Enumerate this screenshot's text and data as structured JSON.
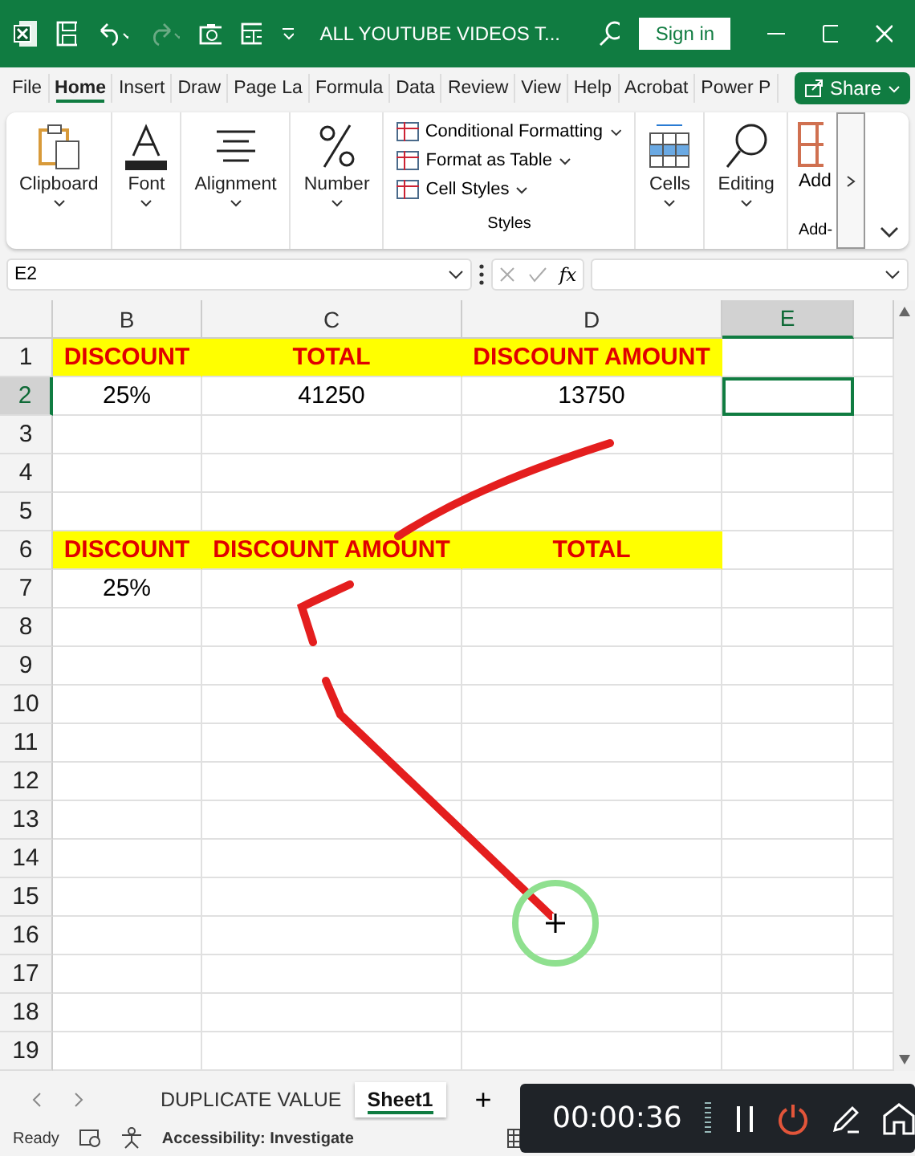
{
  "title_bar": {
    "title": "ALL YOUTUBE VIDEOS T...",
    "sign_in": "Sign in"
  },
  "ribbon_tabs": [
    {
      "label": "File",
      "selected": false
    },
    {
      "label": "Home",
      "selected": true
    },
    {
      "label": "Insert",
      "selected": false
    },
    {
      "label": "Draw",
      "selected": false
    },
    {
      "label": "Page La",
      "selected": false
    },
    {
      "label": "Formula",
      "selected": false
    },
    {
      "label": "Data",
      "selected": false
    },
    {
      "label": "Review",
      "selected": false
    },
    {
      "label": "View",
      "selected": false
    },
    {
      "label": "Help",
      "selected": false
    },
    {
      "label": "Acrobat",
      "selected": false
    },
    {
      "label": "Power P",
      "selected": false
    }
  ],
  "share": "Share",
  "ribbon_groups": [
    {
      "kind": "big",
      "label": "Clipboard"
    },
    {
      "kind": "big",
      "label": "Font"
    },
    {
      "kind": "big",
      "label": "Alignment"
    },
    {
      "kind": "big",
      "label": "Number"
    },
    {
      "kind": "styles",
      "label": "Styles",
      "items": [
        "Conditional Formatting",
        "Format as Table",
        "Cell Styles"
      ]
    },
    {
      "kind": "big",
      "label": "Cells"
    },
    {
      "kind": "big",
      "label": "Editing"
    },
    {
      "kind": "addins",
      "label": "Add",
      "group_label": "Add-"
    }
  ],
  "formula_bar": {
    "name_box": "E2",
    "fx": "fx"
  },
  "sheet": {
    "columns": [
      {
        "label": "B",
        "selected": false
      },
      {
        "label": "C",
        "selected": false
      },
      {
        "label": "D",
        "selected": false
      },
      {
        "label": "E",
        "selected": true
      }
    ],
    "rows": [
      {
        "header": "1",
        "selected": false,
        "cells": [
          {
            "kind": "heading",
            "text": "DISCOUNT",
            "selected": false
          },
          {
            "kind": "heading",
            "text": "TOTAL",
            "selected": false
          },
          {
            "kind": "heading",
            "text": "DISCOUNT AMOUNT",
            "selected": false
          }
        ]
      },
      {
        "header": "2",
        "selected": true,
        "cells": [
          {
            "kind": "value",
            "text": "25%",
            "selected": false
          },
          {
            "kind": "value",
            "text": "41250",
            "selected": false
          },
          {
            "kind": "value",
            "text": "13750",
            "selected": false
          },
          {
            "kind": "value",
            "selected": true
          }
        ]
      },
      {
        "header": "3",
        "selected": false
      },
      {
        "header": "4",
        "selected": false
      },
      {
        "header": "5",
        "selected": false
      },
      {
        "header": "6",
        "selected": false,
        "cells": [
          {
            "kind": "heading",
            "text": "DISCOUNT",
            "selected": false
          },
          {
            "kind": "heading",
            "text": "DISCOUNT AMOUNT",
            "selected": false
          },
          {
            "kind": "heading",
            "text": "TOTAL",
            "selected": false
          }
        ]
      },
      {
        "header": "7",
        "selected": false,
        "cells": [
          {
            "kind": "value",
            "text": "25%",
            "selected": false
          }
        ]
      },
      {
        "header": "8",
        "selected": false
      },
      {
        "header": "9",
        "selected": false
      },
      {
        "header": "10",
        "selected": false
      },
      {
        "header": "11",
        "selected": false
      },
      {
        "header": "12",
        "selected": false
      },
      {
        "header": "13",
        "selected": false
      },
      {
        "header": "14",
        "selected": false
      },
      {
        "header": "15",
        "selected": false
      },
      {
        "header": "16",
        "selected": false
      },
      {
        "header": "17",
        "selected": false
      },
      {
        "header": "18",
        "selected": false
      },
      {
        "header": "19",
        "selected": false
      }
    ]
  },
  "sheet_tabs": [
    {
      "label": "DUPLICATE VALUE",
      "selected": false
    },
    {
      "label": "Sheet1",
      "selected": true
    }
  ],
  "add_sheet": "+",
  "status_bar": {
    "ready": "Ready",
    "accessibility": "Accessibility: Investigate"
  },
  "recorder": {
    "time": "00:00:36"
  }
}
